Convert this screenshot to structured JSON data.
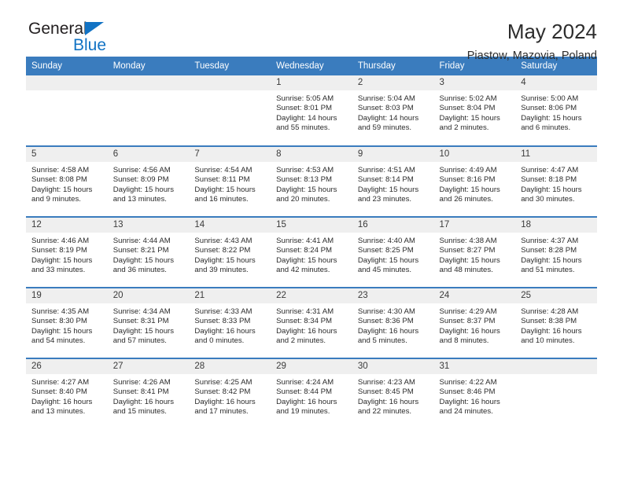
{
  "brand": {
    "name_part1": "General",
    "name_part2": "Blue"
  },
  "header": {
    "title": "May 2024",
    "subtitle": "Piastow, Mazovia, Poland"
  },
  "colors": {
    "header_blue": "#3a7cbe",
    "logo_blue": "#1273c4",
    "daynum_bg": "#efefef"
  },
  "weekdays": [
    "Sunday",
    "Monday",
    "Tuesday",
    "Wednesday",
    "Thursday",
    "Friday",
    "Saturday"
  ],
  "weeks": [
    [
      {
        "day": "",
        "sunrise": "",
        "sunset": "",
        "daylight1": "",
        "daylight2": ""
      },
      {
        "day": "",
        "sunrise": "",
        "sunset": "",
        "daylight1": "",
        "daylight2": ""
      },
      {
        "day": "",
        "sunrise": "",
        "sunset": "",
        "daylight1": "",
        "daylight2": ""
      },
      {
        "day": "1",
        "sunrise": "Sunrise: 5:05 AM",
        "sunset": "Sunset: 8:01 PM",
        "daylight1": "Daylight: 14 hours",
        "daylight2": "and 55 minutes."
      },
      {
        "day": "2",
        "sunrise": "Sunrise: 5:04 AM",
        "sunset": "Sunset: 8:03 PM",
        "daylight1": "Daylight: 14 hours",
        "daylight2": "and 59 minutes."
      },
      {
        "day": "3",
        "sunrise": "Sunrise: 5:02 AM",
        "sunset": "Sunset: 8:04 PM",
        "daylight1": "Daylight: 15 hours",
        "daylight2": "and 2 minutes."
      },
      {
        "day": "4",
        "sunrise": "Sunrise: 5:00 AM",
        "sunset": "Sunset: 8:06 PM",
        "daylight1": "Daylight: 15 hours",
        "daylight2": "and 6 minutes."
      }
    ],
    [
      {
        "day": "5",
        "sunrise": "Sunrise: 4:58 AM",
        "sunset": "Sunset: 8:08 PM",
        "daylight1": "Daylight: 15 hours",
        "daylight2": "and 9 minutes."
      },
      {
        "day": "6",
        "sunrise": "Sunrise: 4:56 AM",
        "sunset": "Sunset: 8:09 PM",
        "daylight1": "Daylight: 15 hours",
        "daylight2": "and 13 minutes."
      },
      {
        "day": "7",
        "sunrise": "Sunrise: 4:54 AM",
        "sunset": "Sunset: 8:11 PM",
        "daylight1": "Daylight: 15 hours",
        "daylight2": "and 16 minutes."
      },
      {
        "day": "8",
        "sunrise": "Sunrise: 4:53 AM",
        "sunset": "Sunset: 8:13 PM",
        "daylight1": "Daylight: 15 hours",
        "daylight2": "and 20 minutes."
      },
      {
        "day": "9",
        "sunrise": "Sunrise: 4:51 AM",
        "sunset": "Sunset: 8:14 PM",
        "daylight1": "Daylight: 15 hours",
        "daylight2": "and 23 minutes."
      },
      {
        "day": "10",
        "sunrise": "Sunrise: 4:49 AM",
        "sunset": "Sunset: 8:16 PM",
        "daylight1": "Daylight: 15 hours",
        "daylight2": "and 26 minutes."
      },
      {
        "day": "11",
        "sunrise": "Sunrise: 4:47 AM",
        "sunset": "Sunset: 8:18 PM",
        "daylight1": "Daylight: 15 hours",
        "daylight2": "and 30 minutes."
      }
    ],
    [
      {
        "day": "12",
        "sunrise": "Sunrise: 4:46 AM",
        "sunset": "Sunset: 8:19 PM",
        "daylight1": "Daylight: 15 hours",
        "daylight2": "and 33 minutes."
      },
      {
        "day": "13",
        "sunrise": "Sunrise: 4:44 AM",
        "sunset": "Sunset: 8:21 PM",
        "daylight1": "Daylight: 15 hours",
        "daylight2": "and 36 minutes."
      },
      {
        "day": "14",
        "sunrise": "Sunrise: 4:43 AM",
        "sunset": "Sunset: 8:22 PM",
        "daylight1": "Daylight: 15 hours",
        "daylight2": "and 39 minutes."
      },
      {
        "day": "15",
        "sunrise": "Sunrise: 4:41 AM",
        "sunset": "Sunset: 8:24 PM",
        "daylight1": "Daylight: 15 hours",
        "daylight2": "and 42 minutes."
      },
      {
        "day": "16",
        "sunrise": "Sunrise: 4:40 AM",
        "sunset": "Sunset: 8:25 PM",
        "daylight1": "Daylight: 15 hours",
        "daylight2": "and 45 minutes."
      },
      {
        "day": "17",
        "sunrise": "Sunrise: 4:38 AM",
        "sunset": "Sunset: 8:27 PM",
        "daylight1": "Daylight: 15 hours",
        "daylight2": "and 48 minutes."
      },
      {
        "day": "18",
        "sunrise": "Sunrise: 4:37 AM",
        "sunset": "Sunset: 8:28 PM",
        "daylight1": "Daylight: 15 hours",
        "daylight2": "and 51 minutes."
      }
    ],
    [
      {
        "day": "19",
        "sunrise": "Sunrise: 4:35 AM",
        "sunset": "Sunset: 8:30 PM",
        "daylight1": "Daylight: 15 hours",
        "daylight2": "and 54 minutes."
      },
      {
        "day": "20",
        "sunrise": "Sunrise: 4:34 AM",
        "sunset": "Sunset: 8:31 PM",
        "daylight1": "Daylight: 15 hours",
        "daylight2": "and 57 minutes."
      },
      {
        "day": "21",
        "sunrise": "Sunrise: 4:33 AM",
        "sunset": "Sunset: 8:33 PM",
        "daylight1": "Daylight: 16 hours",
        "daylight2": "and 0 minutes."
      },
      {
        "day": "22",
        "sunrise": "Sunrise: 4:31 AM",
        "sunset": "Sunset: 8:34 PM",
        "daylight1": "Daylight: 16 hours",
        "daylight2": "and 2 minutes."
      },
      {
        "day": "23",
        "sunrise": "Sunrise: 4:30 AM",
        "sunset": "Sunset: 8:36 PM",
        "daylight1": "Daylight: 16 hours",
        "daylight2": "and 5 minutes."
      },
      {
        "day": "24",
        "sunrise": "Sunrise: 4:29 AM",
        "sunset": "Sunset: 8:37 PM",
        "daylight1": "Daylight: 16 hours",
        "daylight2": "and 8 minutes."
      },
      {
        "day": "25",
        "sunrise": "Sunrise: 4:28 AM",
        "sunset": "Sunset: 8:38 PM",
        "daylight1": "Daylight: 16 hours",
        "daylight2": "and 10 minutes."
      }
    ],
    [
      {
        "day": "26",
        "sunrise": "Sunrise: 4:27 AM",
        "sunset": "Sunset: 8:40 PM",
        "daylight1": "Daylight: 16 hours",
        "daylight2": "and 13 minutes."
      },
      {
        "day": "27",
        "sunrise": "Sunrise: 4:26 AM",
        "sunset": "Sunset: 8:41 PM",
        "daylight1": "Daylight: 16 hours",
        "daylight2": "and 15 minutes."
      },
      {
        "day": "28",
        "sunrise": "Sunrise: 4:25 AM",
        "sunset": "Sunset: 8:42 PM",
        "daylight1": "Daylight: 16 hours",
        "daylight2": "and 17 minutes."
      },
      {
        "day": "29",
        "sunrise": "Sunrise: 4:24 AM",
        "sunset": "Sunset: 8:44 PM",
        "daylight1": "Daylight: 16 hours",
        "daylight2": "and 19 minutes."
      },
      {
        "day": "30",
        "sunrise": "Sunrise: 4:23 AM",
        "sunset": "Sunset: 8:45 PM",
        "daylight1": "Daylight: 16 hours",
        "daylight2": "and 22 minutes."
      },
      {
        "day": "31",
        "sunrise": "Sunrise: 4:22 AM",
        "sunset": "Sunset: 8:46 PM",
        "daylight1": "Daylight: 16 hours",
        "daylight2": "and 24 minutes."
      },
      {
        "day": "",
        "sunrise": "",
        "sunset": "",
        "daylight1": "",
        "daylight2": ""
      }
    ]
  ]
}
